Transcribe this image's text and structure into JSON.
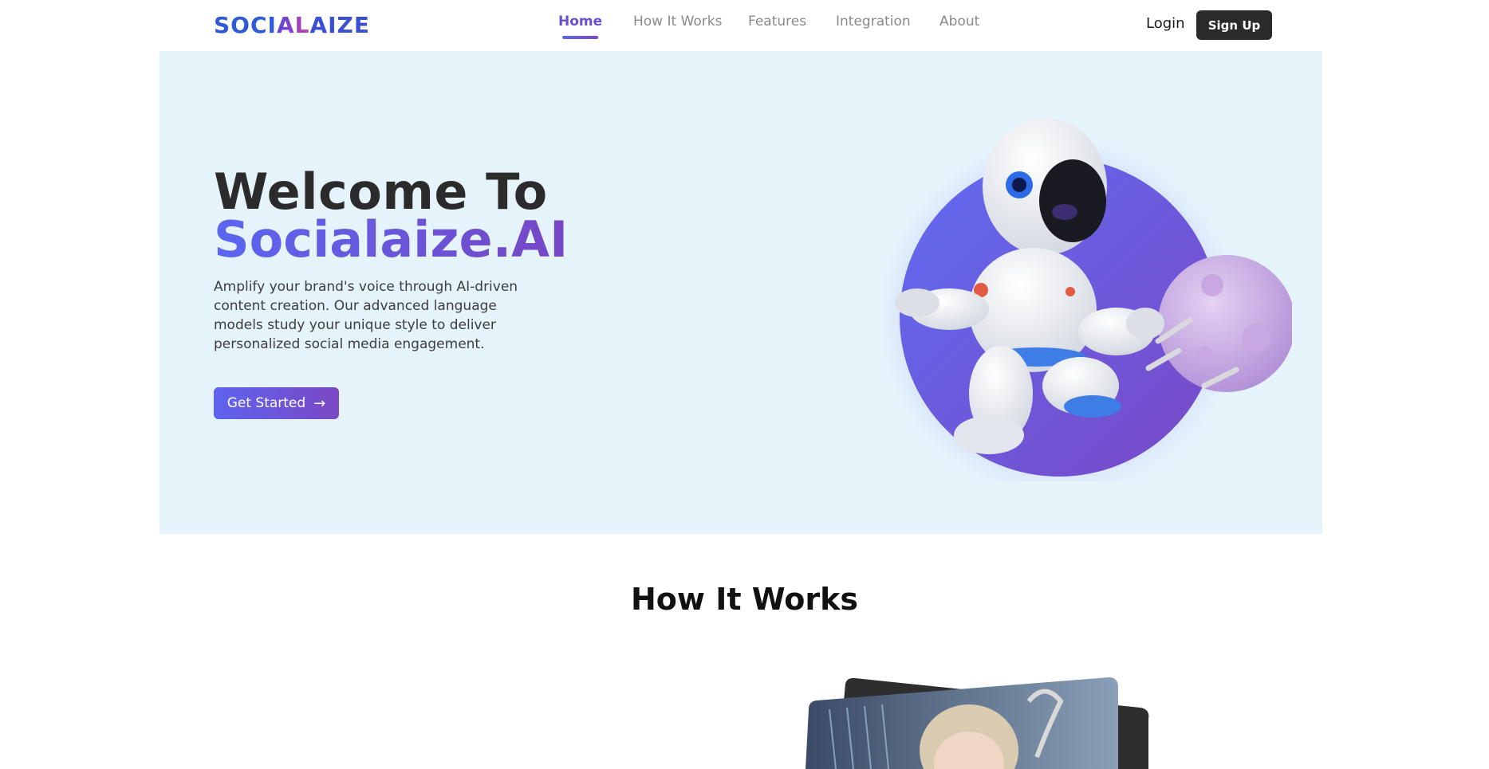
{
  "brand": {
    "logo_part1": "SOCI",
    "logo_part2": "AL",
    "logo_part3": "AIZE"
  },
  "nav": {
    "items": [
      {
        "label": "Home",
        "active": true
      },
      {
        "label": "How It Works",
        "active": false
      },
      {
        "label": "Features",
        "active": false
      },
      {
        "label": "Integration",
        "active": false
      },
      {
        "label": "About",
        "active": false
      }
    ],
    "login_label": "Login",
    "signup_label": "Sign Up"
  },
  "hero": {
    "title_line1": "Welcome To",
    "title_line2": "Socialaize.AI",
    "description": "Amplify your brand's voice through AI-driven content creation. Our advanced language models study your unique style to deliver personalized social media engagement.",
    "cta_label": "Get Started",
    "cta_icon": "arrow-right-icon",
    "illustration": "astronaut-with-planet"
  },
  "how_it_works": {
    "title": "How It Works",
    "image": "person-portrait-cards"
  },
  "colors": {
    "accent_start": "#5b66f0",
    "accent_end": "#7646c4",
    "hero_bg": "#e5f3fb",
    "dark_button": "#2a2a2a",
    "logo_blue": "#2f5bd8"
  }
}
